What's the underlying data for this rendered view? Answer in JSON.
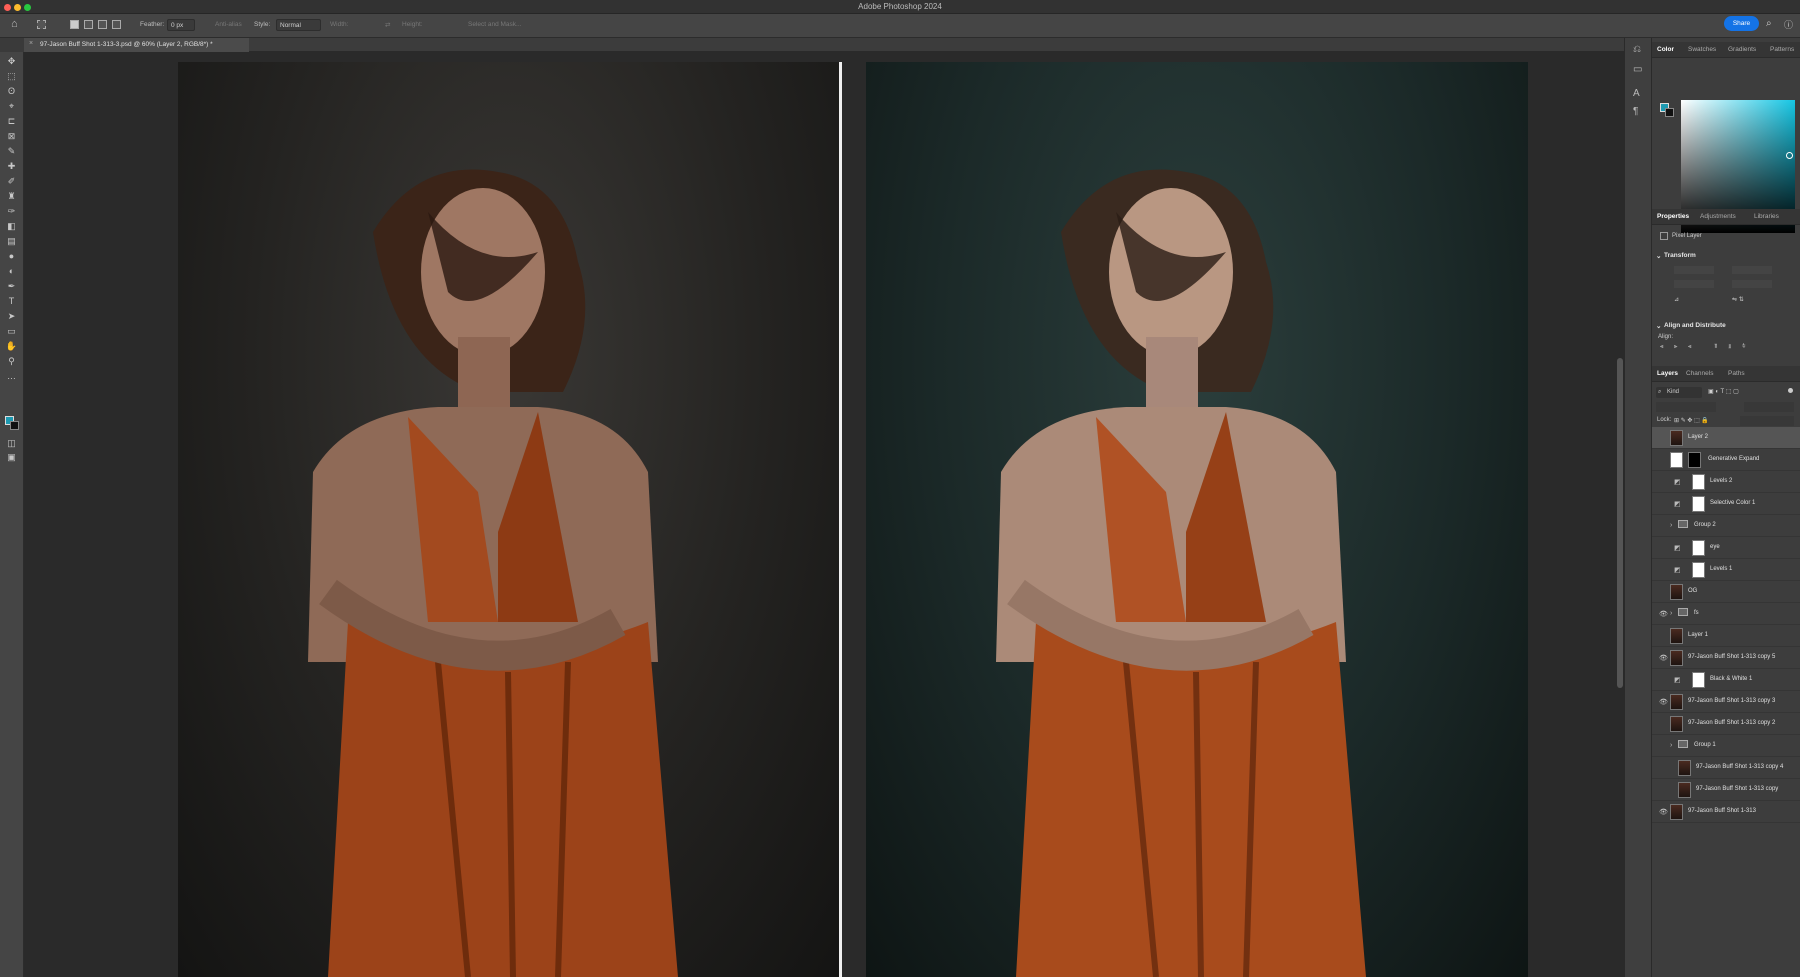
{
  "window": {
    "title": "Adobe Photoshop 2024"
  },
  "options_bar": {
    "feather_label": "Feather:",
    "feather_value": "0 px",
    "anti_alias": "Anti-alias",
    "style_label": "Style:",
    "style_value": "Normal",
    "width_label": "Width:",
    "height_label": "Height:",
    "select_mask": "Select and Mask...",
    "share_label": "Share"
  },
  "document": {
    "tab_title": "97-Jason Buff Shot 1-313-3.psd @ 60% (Layer 2, RGB/8*) *"
  },
  "tools": [
    {
      "icon": "move-icon",
      "glyph": "✥"
    },
    {
      "icon": "marquee-icon",
      "glyph": "⬚"
    },
    {
      "icon": "lasso-icon",
      "glyph": "ʘ"
    },
    {
      "icon": "object-select-icon",
      "glyph": "⌖"
    },
    {
      "icon": "crop-icon",
      "glyph": "⊏"
    },
    {
      "icon": "frame-icon",
      "glyph": "⊠"
    },
    {
      "icon": "eyedropper-icon",
      "glyph": "✎"
    },
    {
      "icon": "healing-icon",
      "glyph": "✚"
    },
    {
      "icon": "brush-icon",
      "glyph": "✐"
    },
    {
      "icon": "stamp-icon",
      "glyph": "♜"
    },
    {
      "icon": "history-brush-icon",
      "glyph": "✑"
    },
    {
      "icon": "eraser-icon",
      "glyph": "◧"
    },
    {
      "icon": "gradient-icon",
      "glyph": "▤"
    },
    {
      "icon": "blur-icon",
      "glyph": "●"
    },
    {
      "icon": "dodge-icon",
      "glyph": "◐"
    },
    {
      "icon": "pen-icon",
      "glyph": "✒"
    },
    {
      "icon": "type-icon",
      "glyph": "T"
    },
    {
      "icon": "path-select-icon",
      "glyph": "➤"
    },
    {
      "icon": "shape-icon",
      "glyph": "▭"
    },
    {
      "icon": "hand-icon",
      "glyph": "✋"
    },
    {
      "icon": "zoom-icon",
      "glyph": "⚲"
    },
    {
      "icon": "more-tools-icon",
      "glyph": "…"
    }
  ],
  "colors": {
    "accent": "#1473e6",
    "foreground": "#1d9ab2",
    "background": "#111111"
  },
  "color_panel": {
    "tabs": [
      "Color",
      "Swatches",
      "Gradients",
      "Patterns"
    ]
  },
  "properties_panel": {
    "tabs": [
      "Properties",
      "Adjustments",
      "Libraries"
    ],
    "layer_type": "Pixel Layer",
    "transform_label": "Transform",
    "align_label": "Align and Distribute",
    "align_sub": "Align:"
  },
  "layers_panel": {
    "tabs": [
      "Layers",
      "Channels",
      "Paths"
    ],
    "kind_label": "Kind",
    "lock_label": "Lock:",
    "layers": [
      {
        "name": "Layer 2",
        "eye": "",
        "type": "pixel"
      },
      {
        "name": "Generative Expand",
        "eye": "",
        "type": "pixel-mask"
      },
      {
        "name": "Levels 2",
        "eye": "",
        "type": "adjustment"
      },
      {
        "name": "Selective Color 1",
        "eye": "",
        "type": "adjustment"
      },
      {
        "name": "Group 2",
        "eye": "",
        "type": "group"
      },
      {
        "name": "eye",
        "eye": "",
        "type": "adjustment"
      },
      {
        "name": "Levels 1",
        "eye": "",
        "type": "adjustment"
      },
      {
        "name": "OG",
        "eye": "",
        "type": "pixel"
      },
      {
        "name": "fs",
        "eye": "👁",
        "type": "group"
      },
      {
        "name": "Layer 1",
        "eye": "",
        "type": "pixel"
      },
      {
        "name": "97-Jason Buff Shot 1-313 copy 5",
        "eye": "👁",
        "type": "pixel"
      },
      {
        "name": "Black & White 1",
        "eye": "",
        "type": "adjustment"
      },
      {
        "name": "97-Jason Buff Shot 1-313 copy 3",
        "eye": "👁",
        "type": "pixel"
      },
      {
        "name": "97-Jason Buff Shot 1-313 copy 2",
        "eye": "",
        "type": "pixel"
      },
      {
        "name": "Group 1",
        "eye": "",
        "type": "group"
      },
      {
        "name": "97-Jason Buff Shot 1-313 copy 4",
        "eye": "",
        "type": "pixel-indent"
      },
      {
        "name": "97-Jason Buff Shot 1-313 copy",
        "eye": "",
        "type": "pixel-indent"
      },
      {
        "name": "97-Jason Buff Shot 1-313",
        "eye": "👁",
        "type": "pixel"
      }
    ]
  }
}
